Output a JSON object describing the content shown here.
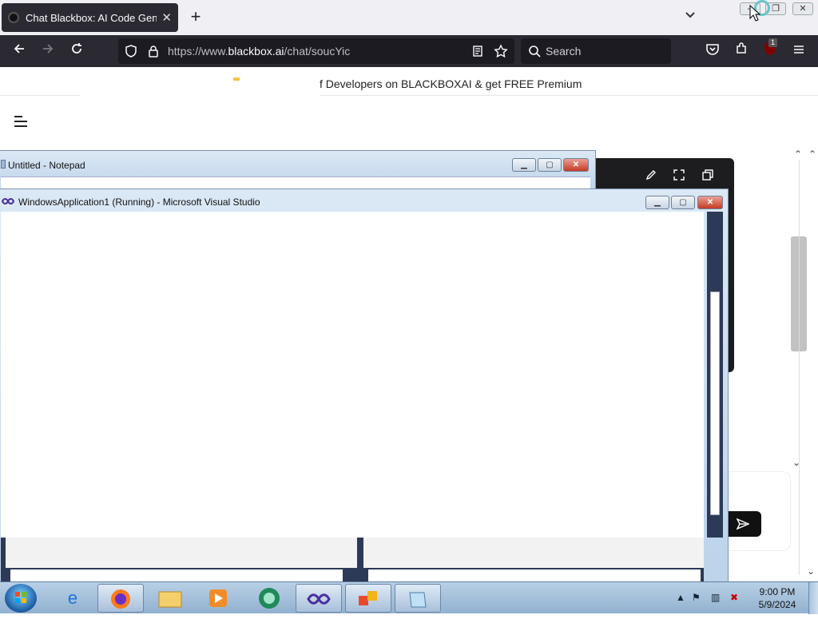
{
  "browser": {
    "tab_title": "Chat Blackbox: AI Code Genera",
    "tab_close": "✕",
    "new_tab": "+",
    "url_prefix": "https://www.",
    "url_domain": "blackbox.ai",
    "url_path": "/chat/soucYic",
    "search_placeholder": "Search",
    "ext_badge": "1"
  },
  "page": {
    "banner_text": "f Developers on BLACKBOXAI & get FREE Premium"
  },
  "notepad": {
    "title": "Untitled - Notepad"
  },
  "visual_studio": {
    "title": "WindowsApplication1 (Running) - Microsoft Visual Studio"
  },
  "taskbar": {
    "time": "9:00 PM",
    "date": "5/9/2024"
  },
  "icons": [
    "back-icon",
    "forward-icon",
    "reload-icon",
    "shield-icon",
    "lock-icon",
    "reader-icon",
    "star-icon",
    "search-icon",
    "pocket-icon",
    "extensions-icon",
    "menu-icon",
    "hamburger-icon",
    "edit-icon",
    "expand-icon",
    "copy-icon",
    "send-icon"
  ]
}
